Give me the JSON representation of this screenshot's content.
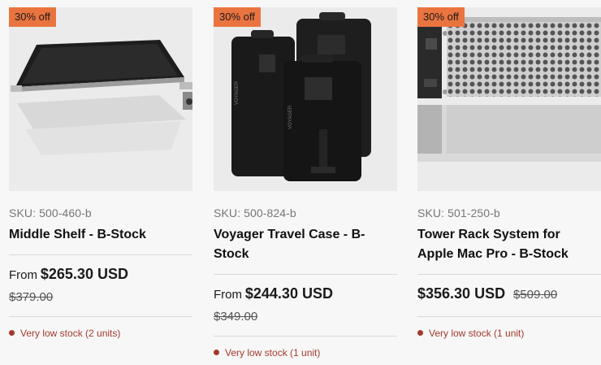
{
  "products": [
    {
      "badge": "30% off",
      "image_alt": "Middle Shelf",
      "sku": "SKU: 500-460-b",
      "title": "Middle Shelf - B-Stock",
      "price_prefix": "From",
      "price": "$265.30 USD",
      "compare_price": "$379.00",
      "stock": "Very low stock (2 units)"
    },
    {
      "badge": "30% off",
      "image_alt": "Voyager Travel Case",
      "sku": "SKU: 500-824-b",
      "title": "Voyager Travel Case - B-Stock",
      "price_prefix": "From",
      "price": "$244.30 USD",
      "compare_price": "$349.00",
      "stock": "Very low stock (1 unit)"
    },
    {
      "badge": "30% off",
      "image_alt": "Tower Rack System for Apple Mac Pro",
      "sku": "SKU: 501-250-b",
      "title": "Tower Rack System for Apple Mac Pro - B-Stock",
      "price_prefix": "",
      "price": "$356.30 USD",
      "compare_price": "$509.00",
      "stock": "Very low stock (1 unit)"
    }
  ],
  "colors": {
    "badge_bg": "#ea7440",
    "stock_red": "#a33a2c",
    "card_bg": "#ebebeb",
    "page_bg": "#f7f7f7"
  }
}
